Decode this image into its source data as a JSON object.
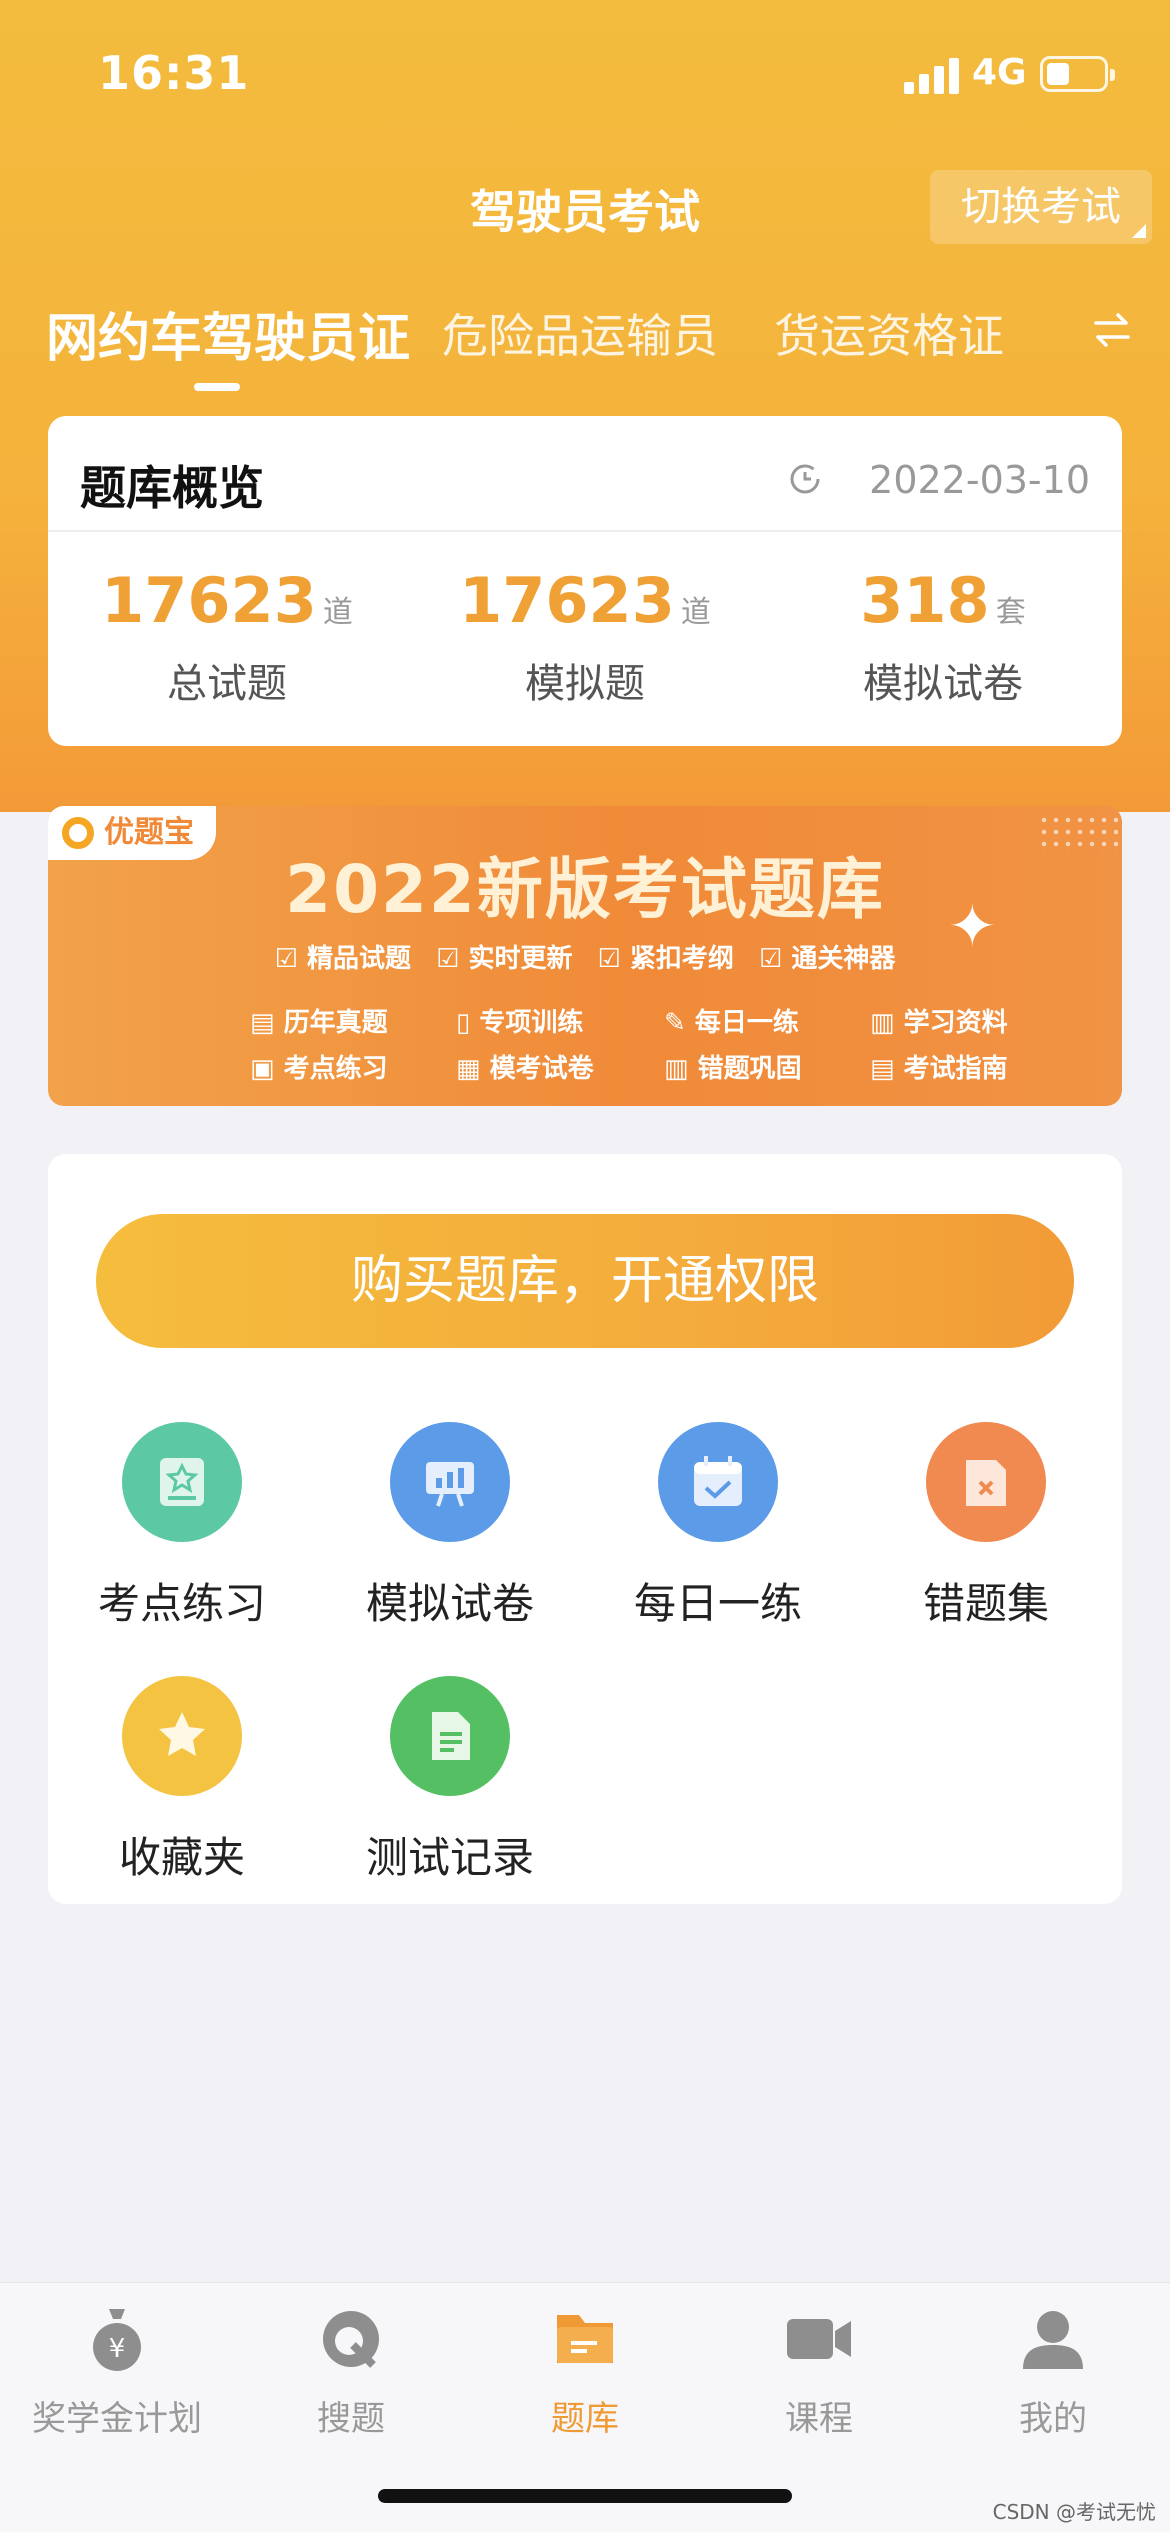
{
  "status_bar": {
    "time": "16:31",
    "network": "4G"
  },
  "header": {
    "title": "驾驶员考试",
    "switch_label": "切换考试"
  },
  "tabs": [
    {
      "label": "网约车驾驶员证",
      "active": true
    },
    {
      "label": "危险品运输员",
      "active": false
    },
    {
      "label": "货运资格证",
      "active": false
    }
  ],
  "overview": {
    "title": "题库概览",
    "date": "2022-03-10",
    "stats": [
      {
        "value": "17623",
        "unit": "道",
        "label": "总试题"
      },
      {
        "value": "17623",
        "unit": "道",
        "label": "模拟题"
      },
      {
        "value": "318",
        "unit": "套",
        "label": "模拟试卷"
      }
    ]
  },
  "banner": {
    "tag": "优题宝",
    "title": "2022新版考试题库",
    "features": [
      "精品试题",
      "实时更新",
      "紧扣考纲",
      "通关神器"
    ],
    "items": [
      "历年真题",
      "专项训练",
      "每日一练",
      "学习资料",
      "考点练习",
      "模考试卷",
      "错题巩固",
      "考试指南"
    ]
  },
  "functions": {
    "buy_label": "购买题库，开通权限",
    "items": [
      {
        "label": "考点练习",
        "icon": "star-book-icon",
        "color": "#5DC9A4"
      },
      {
        "label": "模拟试卷",
        "icon": "chart-board-icon",
        "color": "#5B9BE8"
      },
      {
        "label": "每日一练",
        "icon": "calendar-check-icon",
        "color": "#5B9BE8"
      },
      {
        "label": "错题集",
        "icon": "error-folder-icon",
        "color": "#F08A50"
      },
      {
        "label": "收藏夹",
        "icon": "star-icon",
        "color": "#F5C342"
      },
      {
        "label": "测试记录",
        "icon": "document-icon",
        "color": "#55C063"
      }
    ]
  },
  "nav": [
    {
      "label": "奖学金计划",
      "icon": "money-bag-icon",
      "active": false
    },
    {
      "label": "搜题",
      "icon": "search-q-icon",
      "active": false
    },
    {
      "label": "题库",
      "icon": "folder-icon",
      "active": true
    },
    {
      "label": "课程",
      "icon": "video-camera-icon",
      "active": false
    },
    {
      "label": "我的",
      "icon": "user-icon",
      "active": false
    }
  ],
  "watermark": "CSDN @考试无忧",
  "colors": {
    "accent": "#F0A136",
    "header": "#F4B63D"
  }
}
